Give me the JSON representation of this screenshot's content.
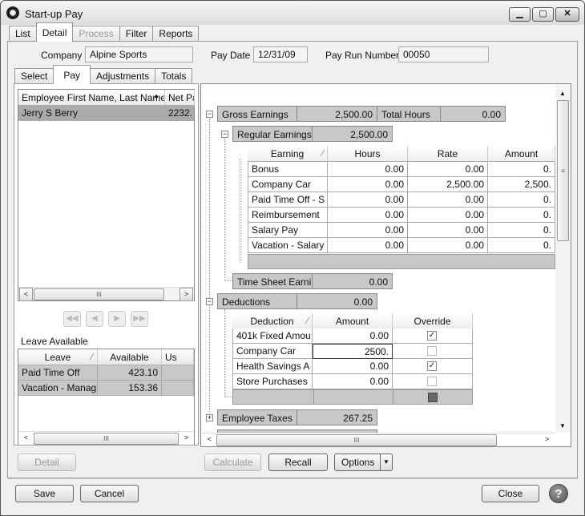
{
  "window": {
    "title": "Start-up Pay",
    "min": "▁",
    "max": "▢",
    "close": "✕"
  },
  "main_tabs": [
    "List",
    "Detail",
    "Process",
    "Filter",
    "Reports"
  ],
  "header": {
    "company_label": "Company",
    "company_value": "Alpine Sports",
    "pay_date_label": "Pay Date",
    "pay_date_value": "12/31/09",
    "pay_run_label": "Pay Run Number",
    "pay_run_value": "00050"
  },
  "sub_tabs": [
    "Select",
    "Pay",
    "Adjustments",
    "Totals"
  ],
  "employee_list": {
    "columns": [
      "Employee First Name, Last Name",
      "Net Pa"
    ],
    "rows": [
      {
        "name": "Jerry S Berry",
        "net": "2232."
      }
    ]
  },
  "leave": {
    "title": "Leave Available",
    "columns": [
      "Leave",
      "Available",
      "Us"
    ],
    "rows": [
      {
        "leave": "Paid Time Off",
        "available": "423.10"
      },
      {
        "leave": "Vacation - Manag",
        "available": "153.36"
      }
    ]
  },
  "gross": {
    "label": "Gross Earnings",
    "value": "2,500.00",
    "total_hours_label": "Total Hours",
    "total_hours_value": "0.00"
  },
  "regular": {
    "label": "Regular Earnings",
    "value": "2,500.00"
  },
  "earnings_table": {
    "columns": [
      "Earning",
      "Hours",
      "Rate",
      "Amount"
    ],
    "rows": [
      {
        "earning": "Bonus",
        "hours": "0.00",
        "rate": "0.00",
        "amount": "0."
      },
      {
        "earning": "Company Car",
        "hours": "0.00",
        "rate": "2,500.00",
        "amount": "2,500."
      },
      {
        "earning": "Paid Time Off - S",
        "hours": "0.00",
        "rate": "0.00",
        "amount": "0."
      },
      {
        "earning": "Reimbursement",
        "hours": "0.00",
        "rate": "0.00",
        "amount": "0."
      },
      {
        "earning": "Salary Pay",
        "hours": "0.00",
        "rate": "0.00",
        "amount": "0."
      },
      {
        "earning": "Vacation - Salary",
        "hours": "0.00",
        "rate": "0.00",
        "amount": "0."
      }
    ]
  },
  "timesheet": {
    "label": "Time Sheet Earni",
    "value": "0.00"
  },
  "deductions": {
    "label": "Deductions",
    "value": "0.00"
  },
  "deduction_table": {
    "columns": [
      "Deduction",
      "Amount",
      "Override"
    ],
    "rows": [
      {
        "deduction": "401k Fixed Amou",
        "amount": "0.00",
        "override": true
      },
      {
        "deduction": "Company Car",
        "amount": "2500.",
        "override": false
      },
      {
        "deduction": "Health Savings A",
        "amount": "0.00",
        "override": true
      },
      {
        "deduction": "Store Purchases",
        "amount": "0.00",
        "override": false
      }
    ]
  },
  "employee_taxes": {
    "label": "Employee Taxes",
    "value": "267.25"
  },
  "buttons": {
    "detail": "Detail",
    "calculate": "Calculate",
    "recall": "Recall",
    "options": "Options",
    "save": "Save",
    "cancel": "Cancel",
    "close": "Close",
    "help": "?"
  },
  "icons": {
    "scroll_left": "<",
    "scroll_right": ">",
    "thumb": "III",
    "first": "◀◀",
    "prev": "◀",
    "next": "▶",
    "last": "▶▶",
    "dropdown": "▼",
    "sort": "⁄",
    "collapse": "−",
    "expand": "+",
    "check": "✓"
  }
}
